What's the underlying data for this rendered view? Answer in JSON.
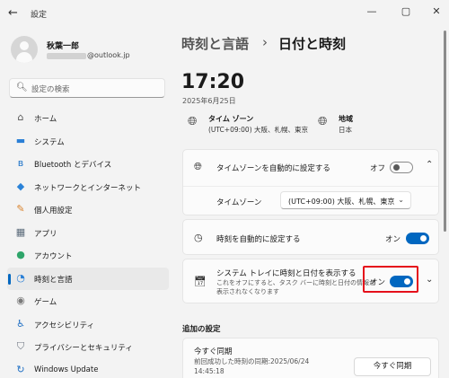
{
  "window": {
    "title": "設定",
    "back_glyph": "←",
    "min_glyph": "—",
    "max_glyph": "▢",
    "close_glyph": "✕"
  },
  "profile": {
    "name": "秋葉一郎",
    "email_domain": "@outlook.jp"
  },
  "search": {
    "placeholder": "設定の検索",
    "icon": "search-icon"
  },
  "sidebar": {
    "items": [
      {
        "label": "ホーム",
        "icon": "home-icon",
        "glyph": "⌂",
        "color": "#555555"
      },
      {
        "label": "システム",
        "icon": "system-icon",
        "glyph": "▬",
        "color": "#2a7fd6"
      },
      {
        "label": "Bluetooth とデバイス",
        "icon": "bluetooth-icon",
        "glyph": "ʙ",
        "color": "#1e73c8"
      },
      {
        "label": "ネットワークとインターネット",
        "icon": "network-icon",
        "glyph": "◆",
        "color": "#2a82d8"
      },
      {
        "label": "個人用設定",
        "icon": "personalization-icon",
        "glyph": "✎",
        "color": "#d9822b"
      },
      {
        "label": "アプリ",
        "icon": "apps-icon",
        "glyph": "▦",
        "color": "#5a6a7a"
      },
      {
        "label": "アカウント",
        "icon": "accounts-icon",
        "glyph": "●",
        "color": "#2fa56a"
      },
      {
        "label": "時刻と言語",
        "icon": "time-language-icon",
        "glyph": "◔",
        "color": "#2a7fd6",
        "active": true
      },
      {
        "label": "ゲーム",
        "icon": "gaming-icon",
        "glyph": "◉",
        "color": "#7a7a7a"
      },
      {
        "label": "アクセシビリティ",
        "icon": "accessibility-icon",
        "glyph": "♿",
        "color": "#1f6fc4"
      },
      {
        "label": "プライバシーとセキュリティ",
        "icon": "privacy-shield-icon",
        "glyph": "⛉",
        "color": "#6c7480"
      },
      {
        "label": "Windows Update",
        "icon": "windows-update-icon",
        "glyph": "↻",
        "color": "#1f6fc4"
      }
    ]
  },
  "breadcrumb": {
    "parent": "時刻と言語",
    "separator": "›",
    "current": "日付と時刻"
  },
  "clock": {
    "time": "17:20",
    "date": "2025年6月25日"
  },
  "timezone_info": {
    "title": "タイム ゾーン",
    "value": "(UTC+09:00) 大阪、札幌、東京",
    "icon": "globe-clock-icon"
  },
  "region_info": {
    "title": "地域",
    "value": "日本",
    "icon": "globe-icon"
  },
  "auto_timezone": {
    "label": "タイムゾーンを自動的に設定する",
    "state_text": "オフ",
    "on": false
  },
  "timezone_select": {
    "label": "タイムゾーン",
    "value": "(UTC+09:00) 大阪、札幌、東京"
  },
  "auto_time": {
    "label": "時刻を自動的に設定する",
    "state_text": "オン",
    "on": true
  },
  "tray_time": {
    "label": "システム トレイに時刻と日付を表示する",
    "desc_line1": "これをオフにすると、タスク バーに時刻と日付の情報が",
    "desc_line2": "表示されなくなります",
    "state_text": "オン",
    "on": true
  },
  "additional": {
    "heading": "追加の設定"
  },
  "sync": {
    "title": "今すぐ同期",
    "detail_line1": "前回成功した時刻の同期:2025/06/24",
    "detail_line2": "14:45:18",
    "button_label": "今すぐ同期"
  },
  "colors": {
    "accent": "#0067c0",
    "highlight_border": "#e5101b"
  }
}
